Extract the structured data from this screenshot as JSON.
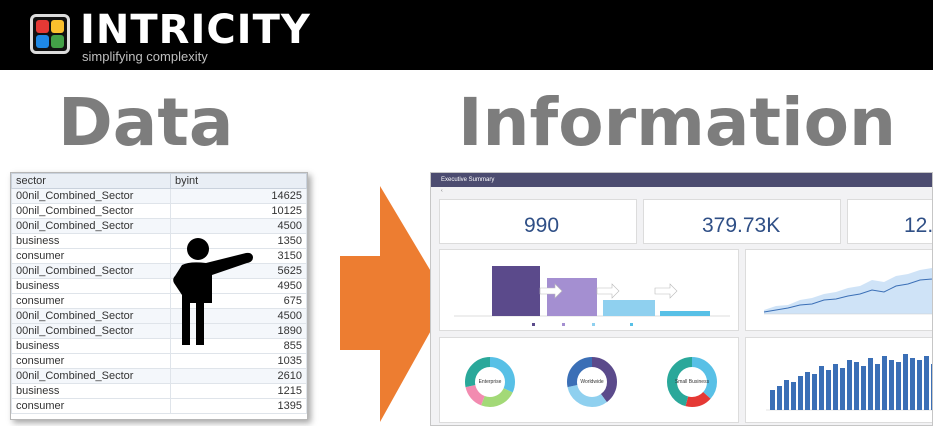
{
  "header": {
    "brand": "INTRICITY",
    "tagline": "simplifying complexity"
  },
  "headings": {
    "left": "Data",
    "right": "Information"
  },
  "table": {
    "columns": [
      "sector",
      "byint"
    ],
    "rows": [
      [
        "00nil_Combined_Sector",
        "14625"
      ],
      [
        "00nil_Combined_Sector",
        "10125"
      ],
      [
        "00nil_Combined_Sector",
        "4500"
      ],
      [
        "business",
        "1350"
      ],
      [
        "consumer",
        "3150"
      ],
      [
        "00nil_Combined_Sector",
        "5625"
      ],
      [
        "business",
        "4950"
      ],
      [
        "consumer",
        "675"
      ],
      [
        "00nil_Combined_Sector",
        "4500"
      ],
      [
        "00nil_Combined_Sector",
        "1890"
      ],
      [
        "business",
        "855"
      ],
      [
        "consumer",
        "1035"
      ],
      [
        "00nil_Combined_Sector",
        "2610"
      ],
      [
        "business",
        "1215"
      ],
      [
        "consumer",
        "1395"
      ]
    ]
  },
  "dashboard": {
    "title": "Executive Summary",
    "kpis": [
      {
        "value": "990"
      },
      {
        "value": "379.73K"
      },
      {
        "value": "12."
      }
    ],
    "donuts": [
      {
        "label": "Enterprise"
      },
      {
        "label": "Worldwide"
      },
      {
        "label": "Small Business"
      }
    ]
  },
  "colors": {
    "arrow": "#ed7d31",
    "heading": "#7d7d7d",
    "kpi": "#2f4f86",
    "funnel": [
      "#5b4a8b",
      "#a48fd1",
      "#8fd0ef",
      "#58c0e6"
    ]
  }
}
